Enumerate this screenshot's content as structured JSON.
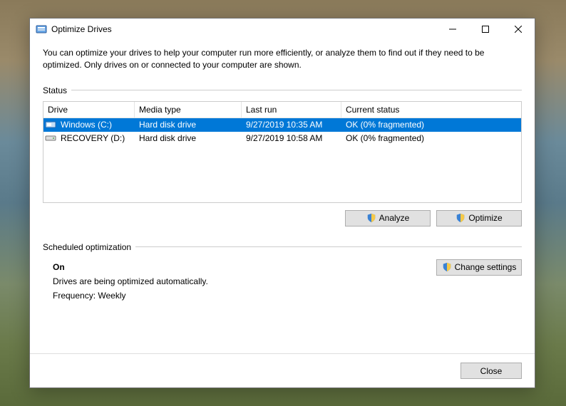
{
  "window": {
    "title": "Optimize Drives"
  },
  "description": "You can optimize your drives to help your computer run more efficiently, or analyze them to find out if they need to be optimized. Only drives on or connected to your computer are shown.",
  "status_label": "Status",
  "columns": {
    "drive": "Drive",
    "media": "Media type",
    "last": "Last run",
    "status": "Current status"
  },
  "drives": [
    {
      "name": "Windows (C:)",
      "media": "Hard disk drive",
      "last": "9/27/2019 10:35 AM",
      "status": "OK (0% fragmented)",
      "selected": true
    },
    {
      "name": "RECOVERY (D:)",
      "media": "Hard disk drive",
      "last": "9/27/2019 10:58 AM",
      "status": "OK (0% fragmented)",
      "selected": false
    }
  ],
  "buttons": {
    "analyze": "Analyze",
    "optimize": "Optimize",
    "change_settings": "Change settings",
    "close": "Close"
  },
  "schedule": {
    "header": "Scheduled optimization",
    "state": "On",
    "desc": "Drives are being optimized automatically.",
    "freq": "Frequency: Weekly"
  }
}
